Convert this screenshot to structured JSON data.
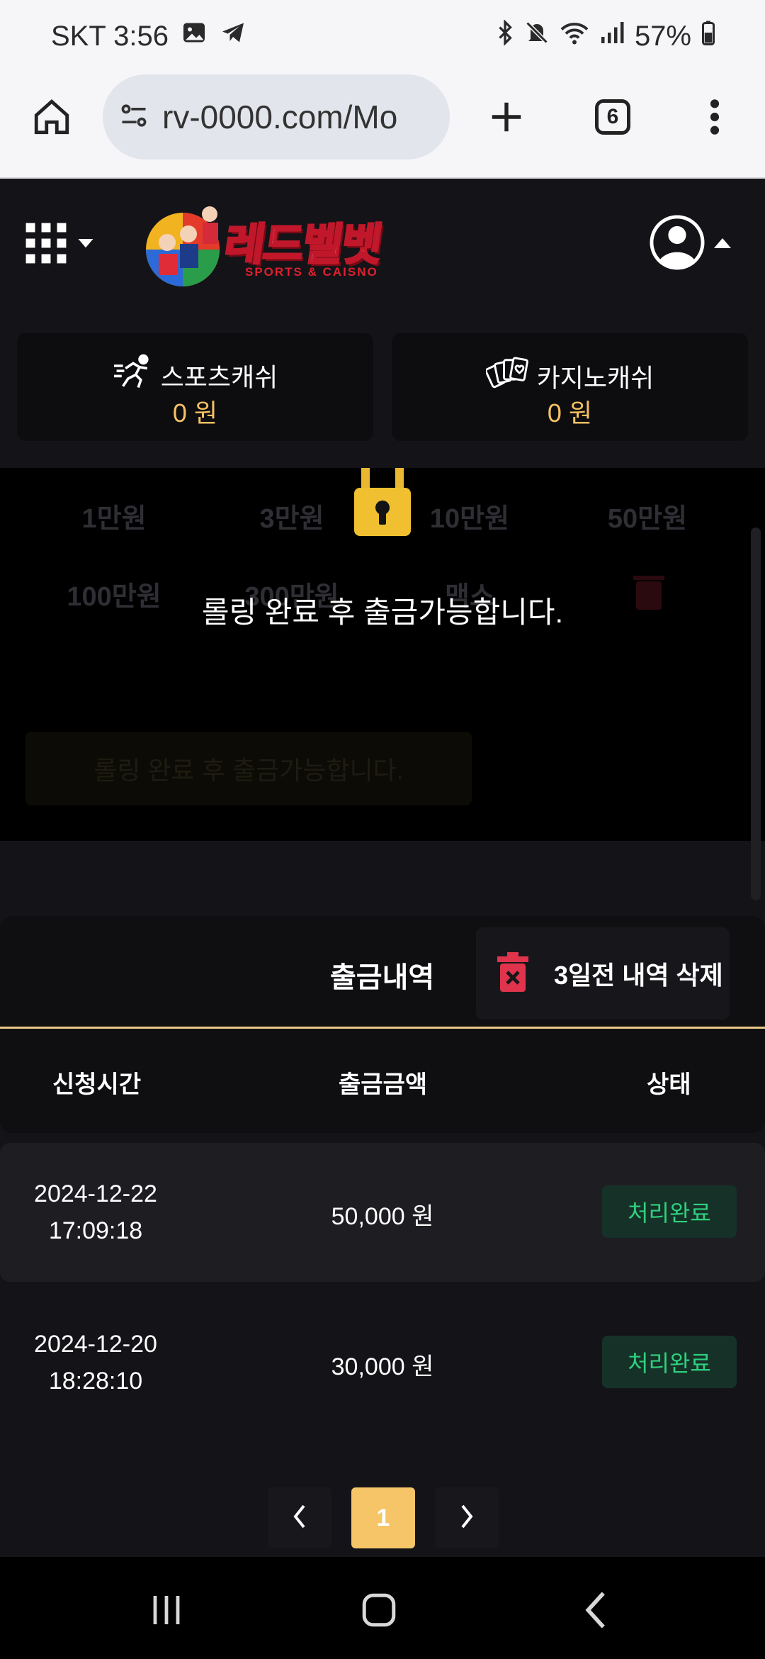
{
  "statusbar": {
    "carrier_time": "SKT 3:56",
    "battery": "57%",
    "icons": [
      "gallery-icon",
      "telegram-icon",
      "bluetooth-icon",
      "mute-icon",
      "wifi-icon",
      "signal-icon",
      "battery-icon"
    ]
  },
  "browser": {
    "url": "rv-0000.com/Mo",
    "tab_count": "6",
    "icons": [
      "home-icon",
      "site-info-icon",
      "new-tab-icon",
      "tabs-icon",
      "more-icon"
    ]
  },
  "header": {
    "logo_title": "레드벨벳",
    "logo_subtitle": "SPORTS & CAISNO",
    "icons": [
      "grid-menu-icon",
      "user-avatar-icon"
    ]
  },
  "cash": [
    {
      "label": "스포츠캐쉬",
      "value": "0 원",
      "icon": "runner-icon"
    },
    {
      "label": "카지노캐쉬",
      "value": "0 원",
      "icon": "cards-icon"
    }
  ],
  "withdraw": {
    "amounts": [
      "1만원",
      "3만원",
      "10만원",
      "50만원",
      "100만원",
      "300만원",
      "맥스"
    ],
    "lock_message": "롤링 완료 후 출금가능합니다.",
    "locked_button": "롤링 완료 후 출금가능합니다."
  },
  "history": {
    "title": "출금내역",
    "delete_label": "3일전 내역 삭제",
    "columns": [
      "신청시간",
      "출금금액",
      "상태"
    ],
    "rows": [
      {
        "date": "2024-12-22",
        "time": "17:09:18",
        "amount": "50,000 원",
        "status": "처리완료"
      },
      {
        "date": "2024-12-20",
        "time": "18:28:10",
        "amount": "30,000 원",
        "status": "처리완료"
      }
    ],
    "current_page": "1"
  },
  "colors": {
    "accent": "#f6c567",
    "status_green": "#2fd07e",
    "danger": "#e0344c"
  }
}
